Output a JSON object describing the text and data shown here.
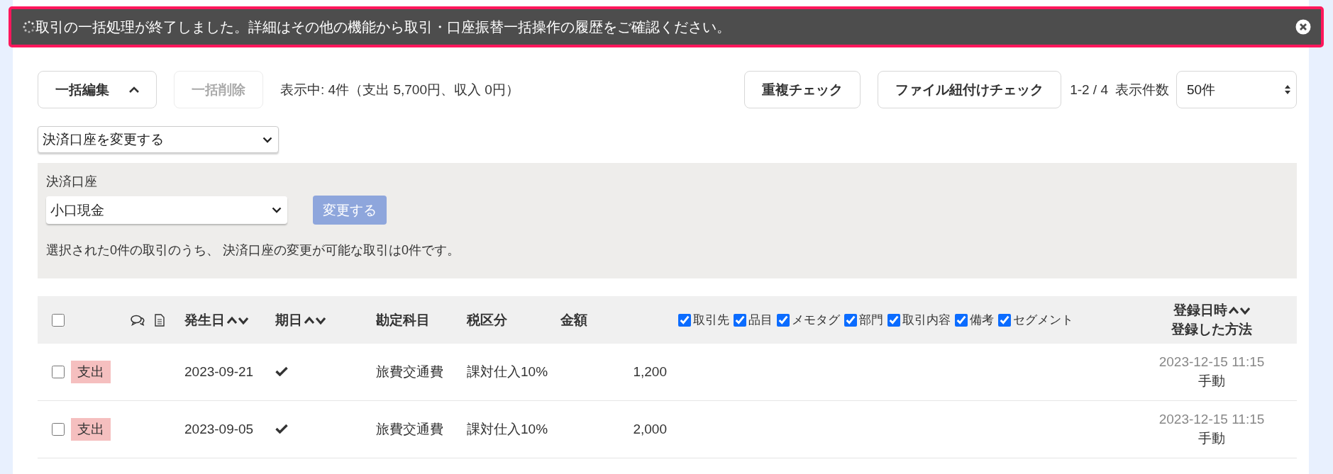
{
  "notification": {
    "message": "取引の一括処理が終了しました。詳細はその他の機能から取引・口座振替一括操作の履歴をご確認ください。"
  },
  "toolbar": {
    "bulk_edit": {
      "label": "一括編集",
      "expanded": true
    },
    "bulk_delete": {
      "label": "一括削除",
      "disabled": true
    },
    "summary": "表示中: 4件（支出 5,700円、収入 0円）",
    "duplicate_check": "重複チェック",
    "file_link_check": "ファイル紐付けチェック",
    "pagination": "1-2 / 4",
    "per_page_label": "表示件数",
    "per_page": "50件"
  },
  "action_select": "決済口座を変更する",
  "panel": {
    "label": "決済口座",
    "account": "小口現金",
    "submit": {
      "label": "変更する",
      "disabled": true
    },
    "message": "選択された0件の取引のうち、 決済口座の変更が可能な取引は0件です。"
  },
  "table": {
    "select_all_checked": false,
    "headers": {
      "issue_date": "発生日",
      "due_date": "期日",
      "account_item": "勘定科目",
      "tax": "税区分",
      "amount": "金額",
      "registered_at": "登録日時",
      "method": "登録した方法"
    },
    "column_toggles": [
      {
        "label": "取引先",
        "checked": true
      },
      {
        "label": "品目",
        "checked": true
      },
      {
        "label": "メモタグ",
        "checked": true
      },
      {
        "label": "部門",
        "checked": true
      },
      {
        "label": "取引内容",
        "checked": true
      },
      {
        "label": "備考",
        "checked": true
      },
      {
        "label": "セグメント",
        "checked": true
      }
    ],
    "rows": [
      {
        "checked": false,
        "kind": "expense",
        "type": "支出",
        "date": "2023-09-21",
        "due_settled": true,
        "account_item": "旅費交通費",
        "tax": "課対仕入10%",
        "amount": "1,200",
        "registered_at": "2023-12-15 11:15",
        "method": "手動"
      },
      {
        "checked": false,
        "kind": "expense",
        "type": "支出",
        "date": "2023-09-05",
        "due_settled": true,
        "account_item": "旅費交通費",
        "tax": "課対仕入10%",
        "amount": "2,000",
        "registered_at": "2023-12-15 11:15",
        "method": "手動"
      }
    ]
  }
}
